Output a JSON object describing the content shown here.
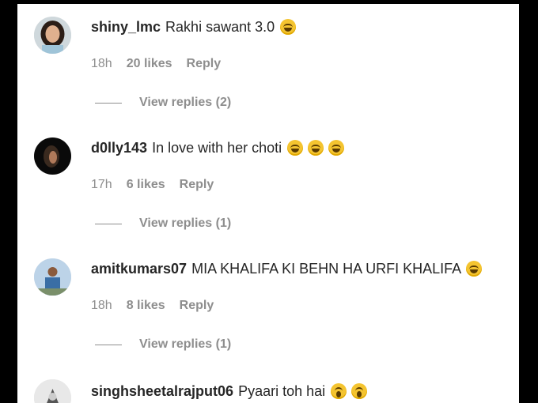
{
  "comments": [
    {
      "username": "shiny_lmc",
      "text": "Rakhi sawant 3.0",
      "emoji": [
        "laugh-cry-emoji"
      ],
      "time": "18h",
      "likes": "20 likes",
      "reply": "Reply",
      "view_replies": "View replies (2)"
    },
    {
      "username": "d0lly143",
      "text": "In love with her choti",
      "emoji": [
        "laugh-cry-emoji",
        "laugh-cry-emoji",
        "laugh-cry-emoji"
      ],
      "time": "17h",
      "likes": "6 likes",
      "reply": "Reply",
      "view_replies": "View replies (1)"
    },
    {
      "username": "amitkumars07",
      "text": "MIA KHALIFA KI BEHN HA URFI KHALIFA",
      "emoji": [
        "laugh-cry-emoji"
      ],
      "time": "18h",
      "likes": "8 likes",
      "reply": "Reply",
      "view_replies": "View replies (1)"
    },
    {
      "username": "singhsheetalrajput06",
      "text": "Pyaari toh hai",
      "emoji": [
        "scream-emoji",
        "scream-emoji"
      ]
    }
  ]
}
